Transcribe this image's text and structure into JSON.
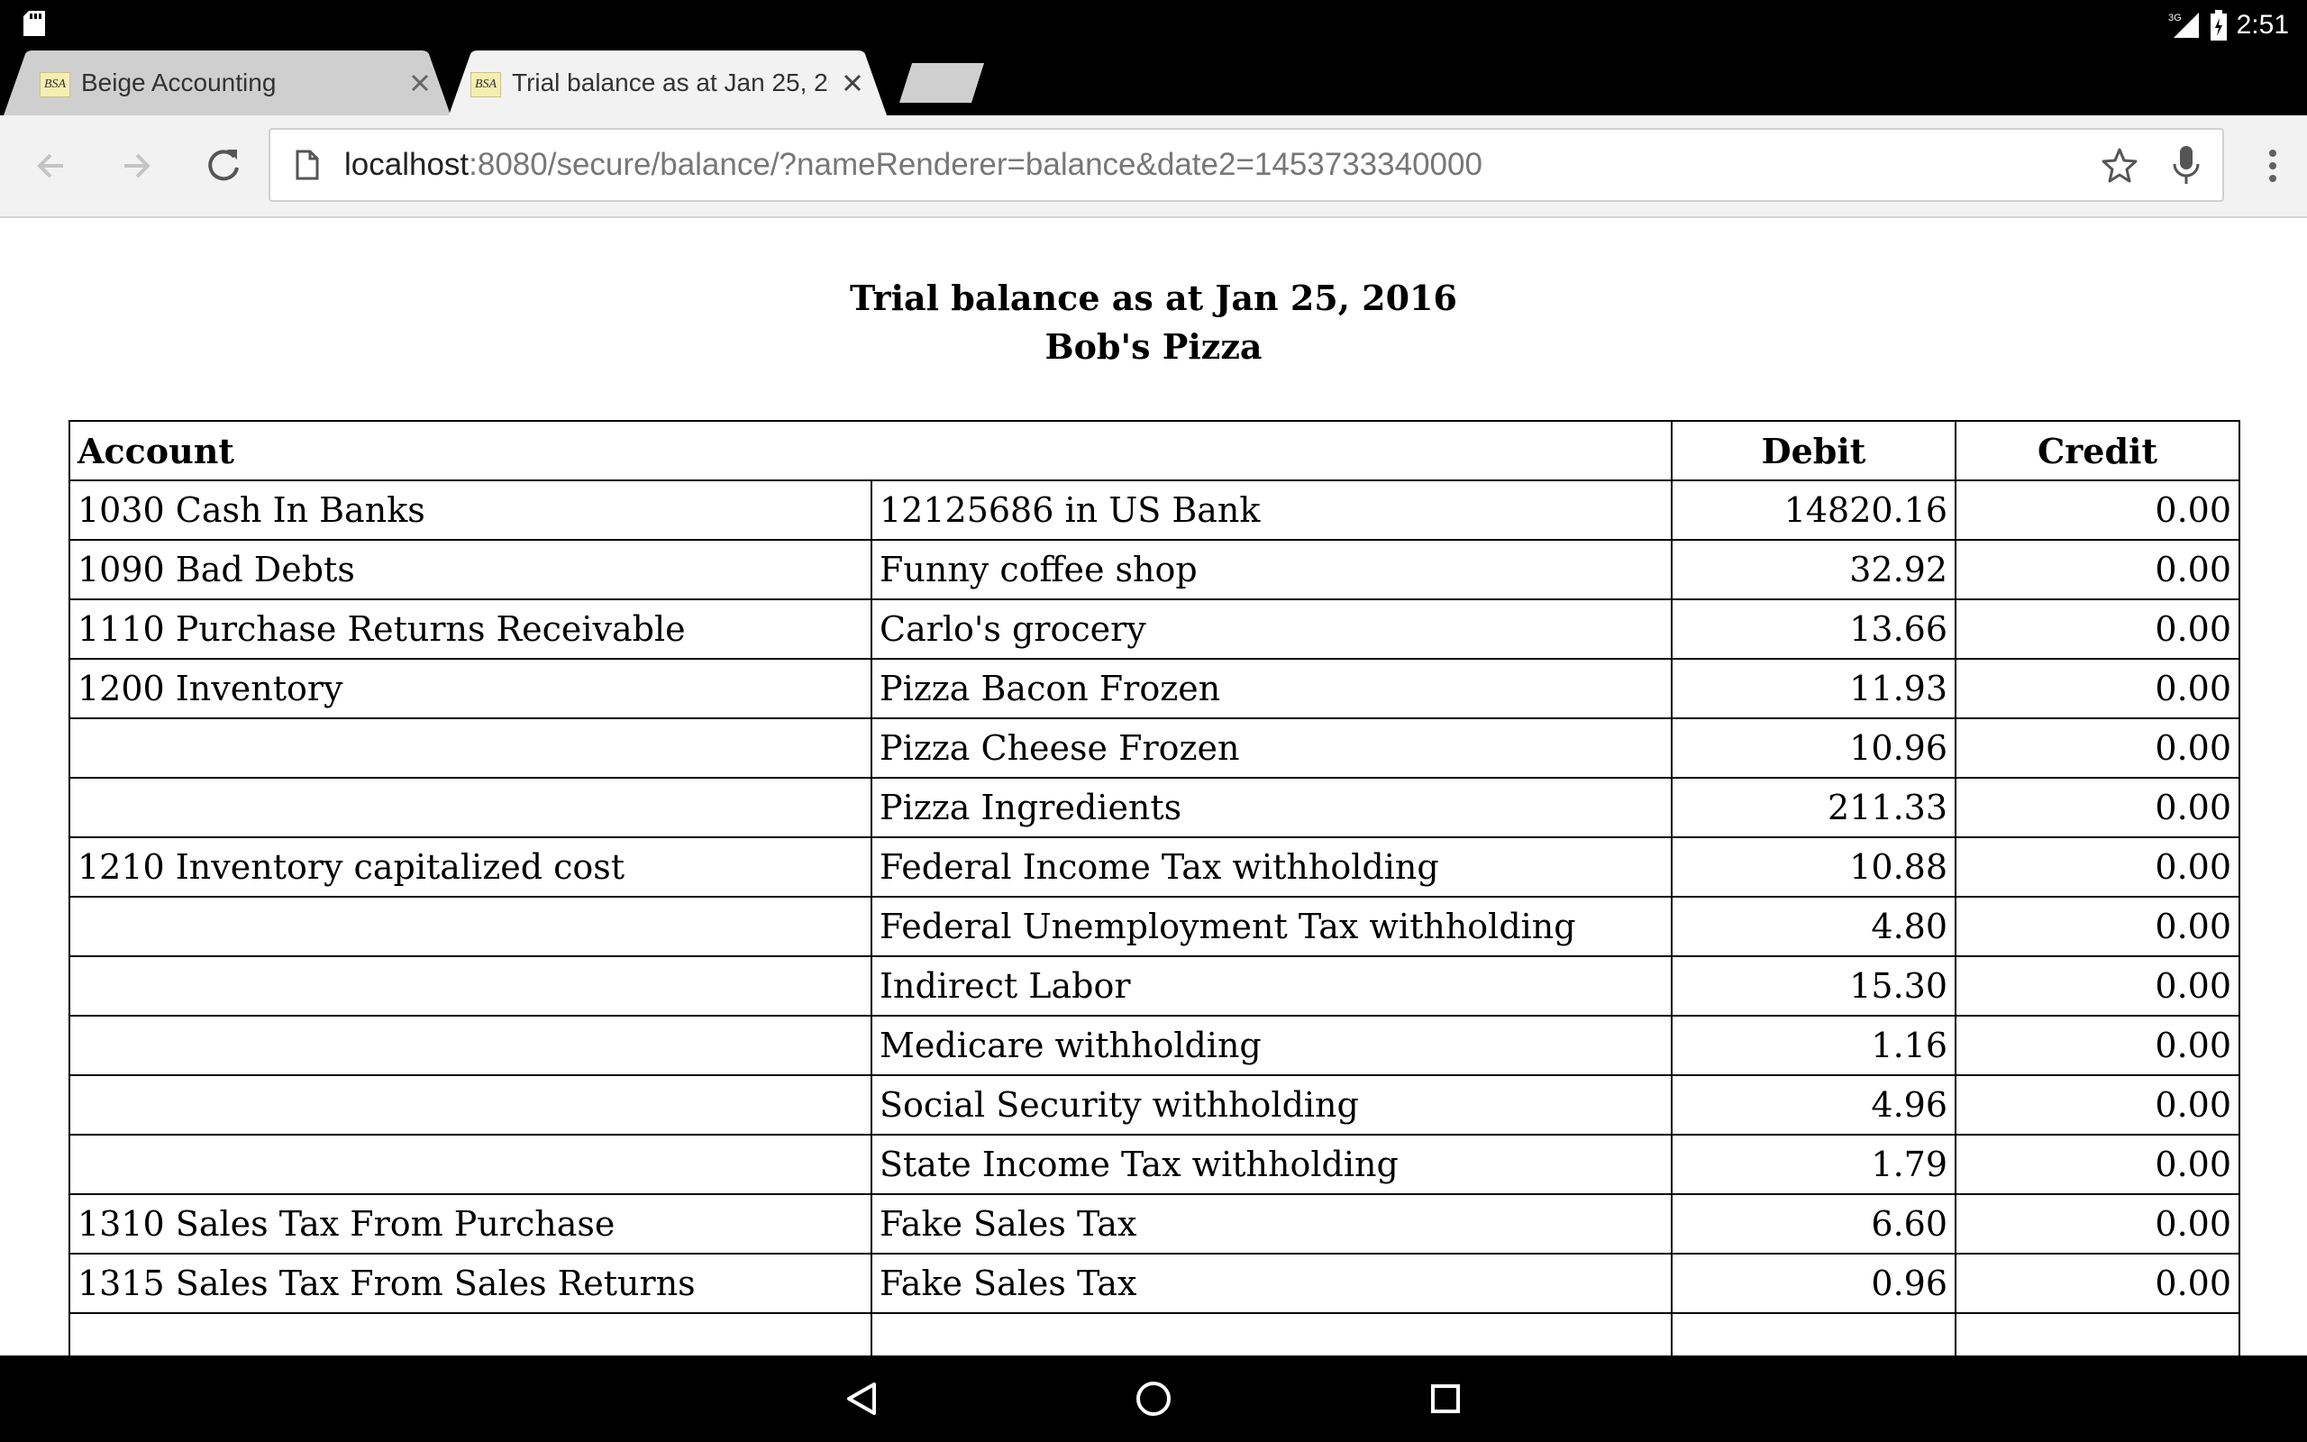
{
  "status_bar": {
    "time": "2:51",
    "network_label": "3G",
    "icons": [
      "sd-card-icon",
      "signal-icon",
      "battery-icon"
    ]
  },
  "tabs": [
    {
      "favicon_text": "BSA",
      "title": "Beige Accounting",
      "active": false
    },
    {
      "favicon_text": "BSA",
      "title": "Trial balance as at Jan 25, 20",
      "active": true
    }
  ],
  "toolbar": {
    "url_host": "localhost",
    "url_rest": ":8080/secure/balance/?nameRenderer=balance&date2=1453733340000",
    "icons": [
      "back-icon",
      "forward-icon",
      "reload-icon",
      "page-icon",
      "star-icon",
      "mic-icon",
      "menu-icon"
    ]
  },
  "report": {
    "title": "Trial balance as at Jan 25, 2016",
    "company": "Bob's Pizza",
    "headers": {
      "account": "Account",
      "debit": "Debit",
      "credit": "Credit"
    },
    "rows": [
      {
        "account": "1030 Cash In Banks",
        "sub": "12125686 in US Bank",
        "debit": "14820.16",
        "credit": "0.00"
      },
      {
        "account": "1090 Bad Debts",
        "sub": "Funny coffee shop",
        "debit": "32.92",
        "credit": "0.00"
      },
      {
        "account": "1110 Purchase Returns Receivable",
        "sub": "Carlo's grocery",
        "debit": "13.66",
        "credit": "0.00"
      },
      {
        "account": "1200 Inventory",
        "sub": "Pizza Bacon Frozen",
        "debit": "11.93",
        "credit": "0.00"
      },
      {
        "account": "",
        "sub": "Pizza Cheese Frozen",
        "debit": "10.96",
        "credit": "0.00"
      },
      {
        "account": "",
        "sub": "Pizza Ingredients",
        "debit": "211.33",
        "credit": "0.00"
      },
      {
        "account": "1210 Inventory capitalized cost",
        "sub": "Federal Income Tax withholding",
        "debit": "10.88",
        "credit": "0.00"
      },
      {
        "account": "",
        "sub": "Federal Unemployment Tax withholding",
        "debit": "4.80",
        "credit": "0.00"
      },
      {
        "account": "",
        "sub": "Indirect Labor",
        "debit": "15.30",
        "credit": "0.00"
      },
      {
        "account": "",
        "sub": "Medicare withholding",
        "debit": "1.16",
        "credit": "0.00"
      },
      {
        "account": "",
        "sub": "Social Security withholding",
        "debit": "4.96",
        "credit": "0.00"
      },
      {
        "account": "",
        "sub": "State Income Tax withholding",
        "debit": "1.79",
        "credit": "0.00"
      },
      {
        "account": "1310 Sales Tax From Purchase",
        "sub": "Fake Sales Tax",
        "debit": "6.60",
        "credit": "0.00"
      },
      {
        "account": "1315 Sales Tax From Sales Returns",
        "sub": "Fake Sales Tax",
        "debit": "0.96",
        "credit": "0.00"
      },
      {
        "account": "",
        "sub": "",
        "debit": "",
        "credit": ""
      }
    ]
  },
  "nav_bar": {
    "icons": [
      "back-triangle-icon",
      "home-circle-icon",
      "recents-square-icon"
    ]
  }
}
